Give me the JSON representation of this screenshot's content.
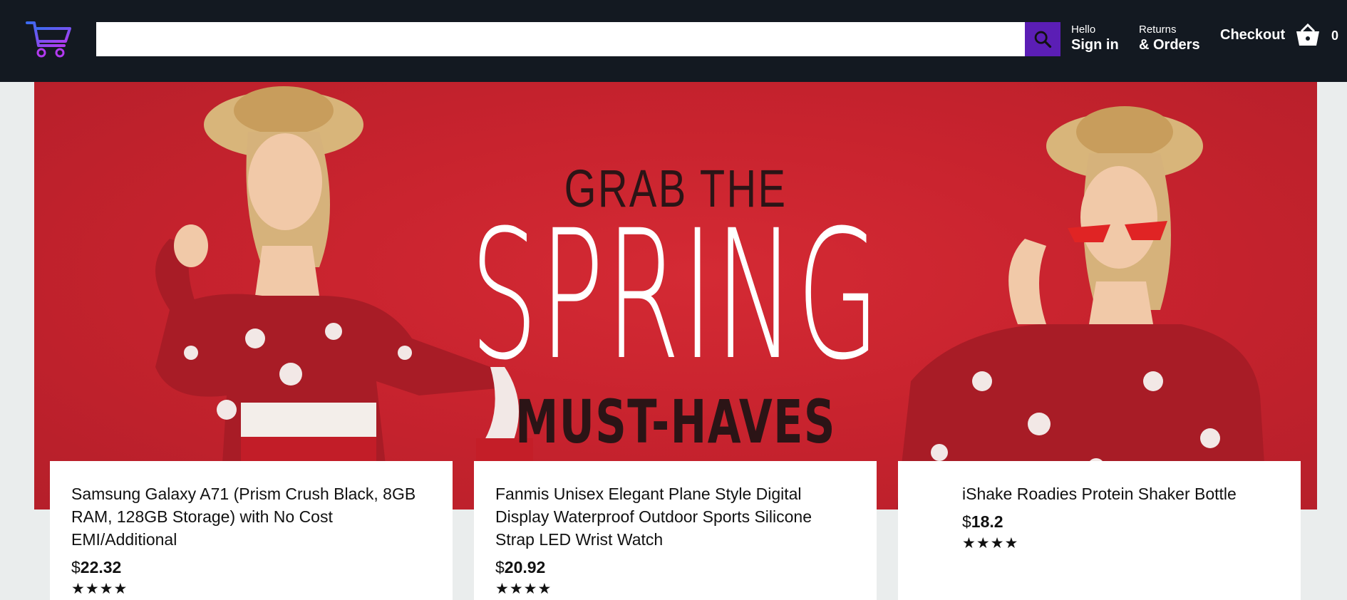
{
  "header": {
    "logo_icon": "shopping-cart-logo",
    "search": {
      "value": "",
      "placeholder": ""
    },
    "signin": {
      "line1": "Hello",
      "line2": "Sign in"
    },
    "orders": {
      "line1": "Returns",
      "line2": "& Orders"
    },
    "checkout_label": "Checkout",
    "basket_icon": "basket-icon",
    "basket_count": "0",
    "search_button_color": "#5b1eb5"
  },
  "banner": {
    "line1": "GRAB THE",
    "line2": "SPRING",
    "line3": "MUST-HAVES",
    "background_color": "#c8232e"
  },
  "products": [
    {
      "title": "Samsung Galaxy A71 (Prism Crush Black, 8GB RAM, 128GB Storage) with No Cost EMI/Additional",
      "currency": "$",
      "price": "22.32",
      "rating": "★★★★"
    },
    {
      "title": "Fanmis Unisex Elegant Plane Style Digital Display Waterproof Outdoor Sports Silicone Strap LED Wrist Watch",
      "currency": "$",
      "price": "20.92",
      "rating": "★★★★"
    },
    {
      "title": "iShake Roadies Protein Shaker Bottle",
      "currency": "$",
      "price": "18.2",
      "rating": "★★★★"
    }
  ]
}
